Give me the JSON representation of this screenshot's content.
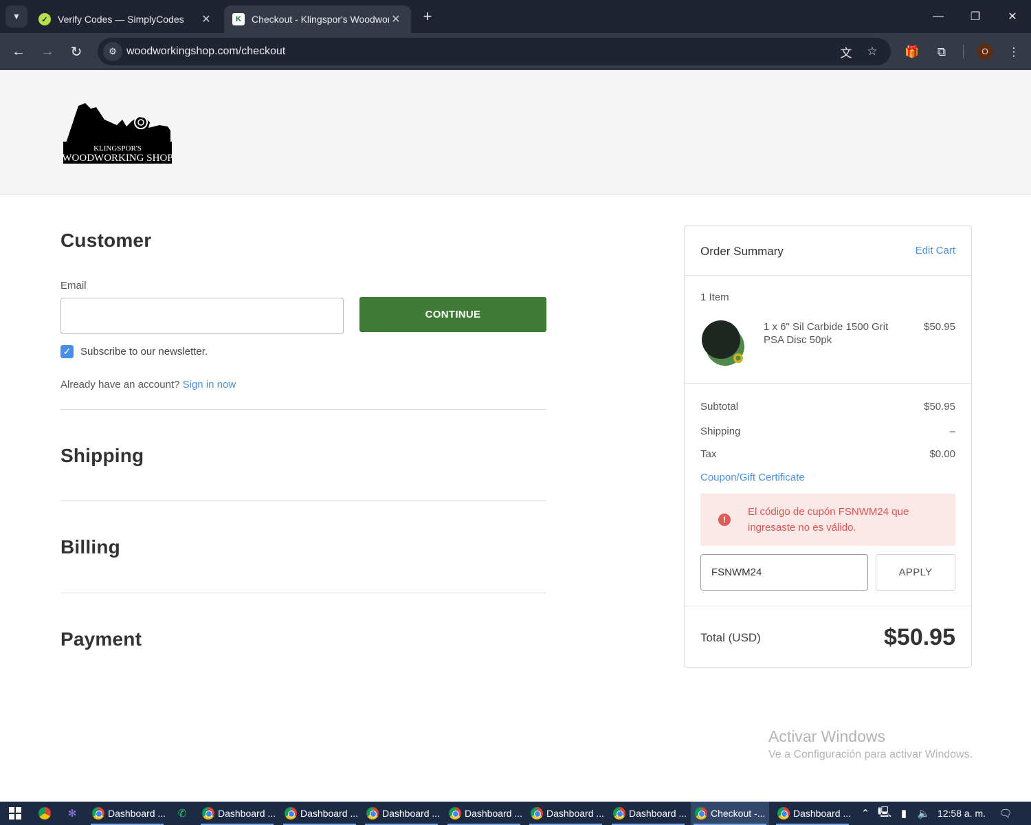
{
  "browser": {
    "tabs": [
      {
        "title": "Verify Codes — SimplyCodes",
        "active": false
      },
      {
        "title": "Checkout - Klingspor's Woodworking Shop",
        "active": true
      }
    ],
    "url": "woodworkingshop.com/checkout",
    "profile_initial": "O"
  },
  "logo": {
    "line1": "KLINGSPOR'S",
    "line2": "WOODWORKING SHOP"
  },
  "checkout": {
    "customer_heading": "Customer",
    "email_label": "Email",
    "email_value": "",
    "continue_label": "CONTINUE",
    "newsletter_label": "Subscribe to our newsletter.",
    "newsletter_checked": true,
    "account_prompt": "Already have an account?",
    "sign_in_label": "Sign in now",
    "shipping_heading": "Shipping",
    "billing_heading": "Billing",
    "payment_heading": "Payment"
  },
  "summary": {
    "title": "Order Summary",
    "edit_cart_label": "Edit Cart",
    "items_count": "1 Item",
    "item": {
      "name": "1 x 6\" Sil Carbide 1500 Grit PSA Disc 50pk",
      "price": "$50.95"
    },
    "subtotal_label": "Subtotal",
    "subtotal_value": "$50.95",
    "shipping_label": "Shipping",
    "shipping_value": "–",
    "tax_label": "Tax",
    "tax_value": "$0.00",
    "coupon_link_label": "Coupon/Gift Certificate",
    "error_message": "El código de cupón FSNWM24 que ingresaste no es válido.",
    "coupon_value": "FSNWM24",
    "apply_label": "APPLY",
    "total_label": "Total (USD)",
    "total_value": "$50.95"
  },
  "watermark": {
    "line1": "Activar Windows",
    "line2": "Ve a Configuración para activar Windows."
  },
  "taskbar": {
    "apps": [
      {
        "label": "Dashboard ...",
        "active": false
      },
      {
        "label": "Dashboard ...",
        "active": false
      },
      {
        "label": "Dashboard ...",
        "active": false
      },
      {
        "label": "Dashboard ...",
        "active": false
      },
      {
        "label": "Dashboard ...",
        "active": false
      },
      {
        "label": "Dashboard ...",
        "active": false
      },
      {
        "label": "Dashboard ...",
        "active": false
      },
      {
        "label": "Checkout -...",
        "active": true
      },
      {
        "label": "Dashboard ...",
        "active": false
      }
    ],
    "clock": "12:58 a. m."
  },
  "colors": {
    "accent_green": "#3e7c35",
    "link_blue": "#4a90e2",
    "error_red": "#d9534f",
    "error_bg": "#fde8e8"
  }
}
